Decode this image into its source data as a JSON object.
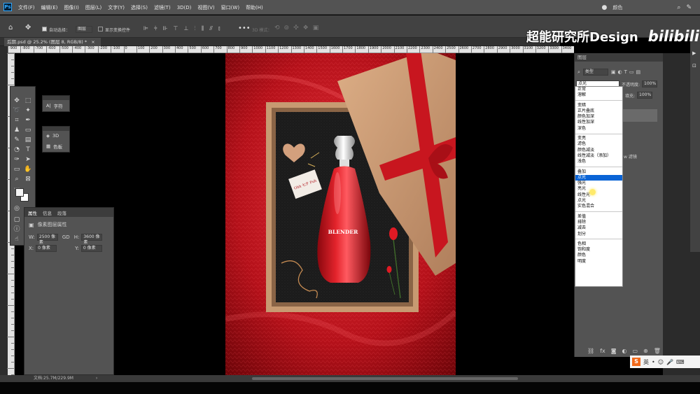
{
  "app": {
    "logo": "Ps",
    "menus": [
      "文件(F)",
      "编辑(E)",
      "图像(I)",
      "图层(L)",
      "文字(Y)",
      "选择(S)",
      "滤镜(T)",
      "3D(D)",
      "视图(V)",
      "窗口(W)",
      "帮助(H)"
    ],
    "workspace_label": "颜色"
  },
  "options": {
    "auto_select_label": "自动选择：",
    "auto_select_value": "图层",
    "show_transform_label": "显示变换控件",
    "mode_3d_label": "3D 模式："
  },
  "document": {
    "tab_title": "后期.psd @ 25.2% (图层 8, RGB/8) *",
    "status": "文档:25.7M/229.9M"
  },
  "ruler": {
    "h_ticks": [
      "-900",
      "-800",
      "-700",
      "-600",
      "-500",
      "-400",
      "-300",
      "-200",
      "-100",
      "0",
      "100",
      "200",
      "300",
      "400",
      "500",
      "600",
      "700",
      "800",
      "900",
      "1000",
      "1100",
      "1200",
      "1300",
      "1400",
      "1500",
      "1600",
      "1700",
      "1800",
      "1900",
      "2000",
      "2100",
      "2200",
      "2300",
      "2400",
      "2500",
      "2600",
      "2700",
      "2800",
      "2900",
      "3000",
      "3100",
      "3200",
      "3300",
      "3400"
    ]
  },
  "mini_panels": {
    "character": "字符",
    "three_d": "3D",
    "swatches": "色板"
  },
  "properties": {
    "tabs": [
      "属性",
      "信息",
      "段落"
    ],
    "title": "像素图层属性",
    "w_label": "W:",
    "w_value": "2500 像素",
    "h_label": "H:",
    "h_value": "3600 像素",
    "x_label": "X:",
    "x_value": "0 像素",
    "y_label": "Y:",
    "y_value": "0 像素",
    "link_label": "GD"
  },
  "layers": {
    "title": "图层",
    "kind_label": "类型",
    "blend_current": "点光",
    "opacity_label": "不透明度:",
    "opacity_value": "100%",
    "fill_label": "填充:",
    "fill_value": "100%",
    "row_label": "w 滤镜"
  },
  "blend_modes": [
    [
      "正常",
      "溶解"
    ],
    [
      "变暗",
      "正片叠底",
      "颜色加深",
      "线性加深",
      "深色"
    ],
    [
      "变亮",
      "滤色",
      "颜色减淡",
      "线性减淡（添加）",
      "浅色"
    ],
    [
      "叠加",
      "点光",
      "强光",
      "亮光",
      "线性光",
      "点光",
      "实色混合"
    ],
    [
      "差值",
      "排除",
      "减去",
      "划分"
    ],
    [
      "色相",
      "饱和度",
      "颜色",
      "明度"
    ]
  ],
  "blend_selected": "点光",
  "artwork": {
    "bottle_text": "BLENDER",
    "card_text": "Ohh 七夕 Puh"
  },
  "watermark": {
    "text": "超能研究所Design",
    "logo": "bilibili"
  },
  "ime": {
    "logo": "S",
    "mode": "英"
  },
  "colors": {
    "highlight": "#0a64d6",
    "bottle_red": "#d11a24",
    "box_tan": "#c99b74"
  }
}
